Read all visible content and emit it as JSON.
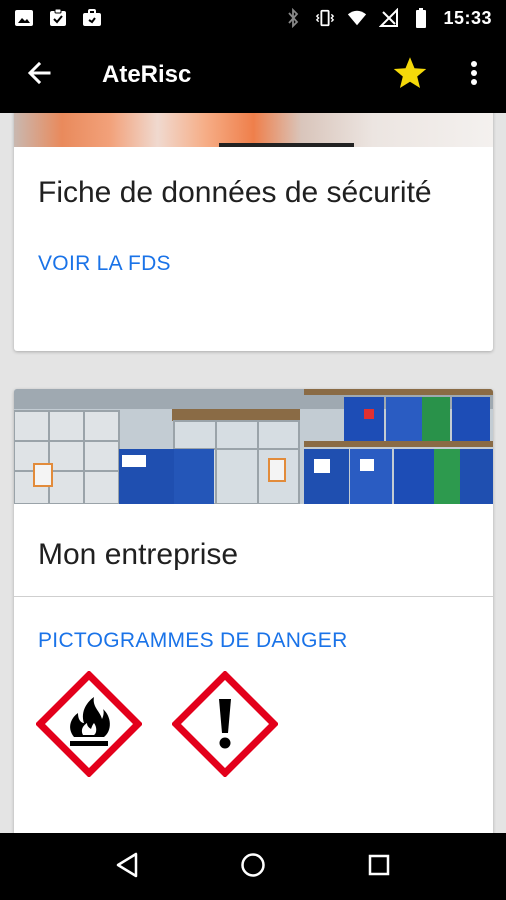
{
  "status_bar": {
    "time": "15:33",
    "icons_left": [
      "image-icon",
      "clipboard-check-icon",
      "briefcase-icon"
    ],
    "icons_right": [
      "bluetooth-icon",
      "vibrate-icon",
      "wifi-icon",
      "no-signal-icon",
      "battery-icon"
    ]
  },
  "app_bar": {
    "title": "AteRisc",
    "back_icon": "arrow-left-icon",
    "favorite_icon": "star-icon",
    "favorite_color": "#f5d90a",
    "menu_icon": "more-vert-icon"
  },
  "cards": [
    {
      "image": "workers-in-safety-vests",
      "title": "Fiche de données de sécurité",
      "action": "VOIR LA FDS"
    },
    {
      "image": "chemical-drums-and-containers",
      "title": "Mon entreprise",
      "action": "PICTOGRAMMES DE DANGER",
      "pictograms": [
        "flammable-pictogram",
        "exclamation-pictogram"
      ]
    }
  ],
  "colors": {
    "accent": "#1a73e8",
    "hazard_red": "#e3001b",
    "bar_background": "#000000"
  },
  "nav_bar": {
    "icons": [
      "back-triangle-icon",
      "home-circle-icon",
      "recents-square-icon"
    ]
  }
}
